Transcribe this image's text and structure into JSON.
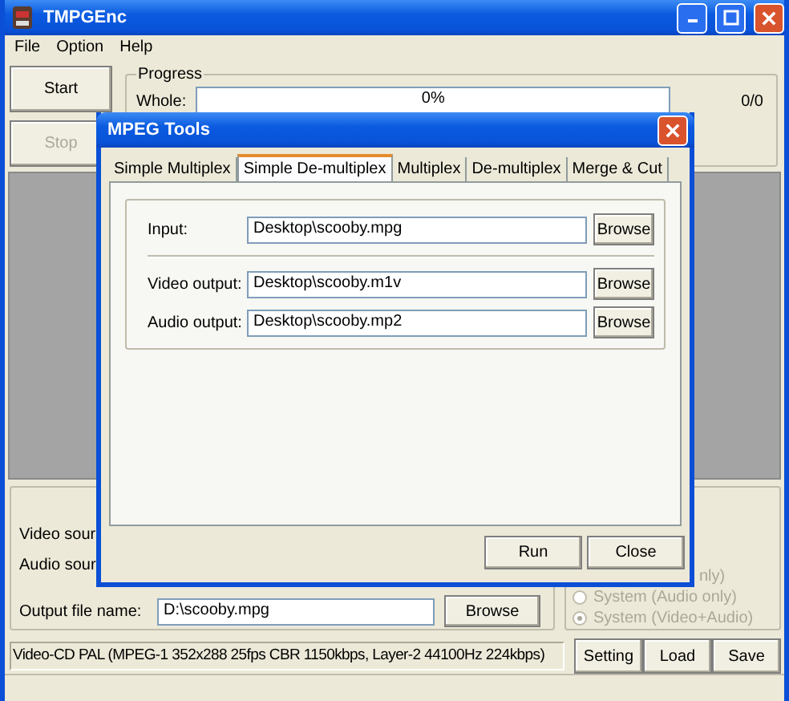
{
  "window": {
    "title": "TMPGEnc",
    "menu": [
      "File",
      "Option",
      "Help"
    ]
  },
  "actions": [
    {
      "label": "Start",
      "disabled": false
    },
    {
      "label": "Stop",
      "disabled": true
    }
  ],
  "progress": {
    "title": "Progress",
    "label": "Whole:",
    "level": 0,
    "reading": "0%",
    "count": "0/0"
  },
  "sources": [
    {
      "label": "Video sour"
    },
    {
      "label": "Audio sour"
    }
  ],
  "output": {
    "label": "Output file name:",
    "value": "D:\\scooby.mpg",
    "button": "Browse"
  },
  "stream_types": [
    {
      "kind": "cut",
      "label": "nly)",
      "disabled": true
    },
    {
      "kind": "radio",
      "label": "System (Audio only)",
      "selected": false,
      "disabled": true
    },
    {
      "kind": "radio",
      "label": "System (Video+Audio)",
      "selected": true,
      "disabled": true
    }
  ],
  "status": "Video-CD PAL (MPEG-1 352x288 25fps CBR 1150kbps,  Layer-2 44100Hz 224kbps)",
  "buttons": [
    "Setting",
    "Load",
    "Save"
  ],
  "dialog": {
    "title": "MPEG Tools",
    "tabs": [
      {
        "label": "Simple Multiplex",
        "selected": false
      },
      {
        "label": "Simple De-multiplex",
        "selected": true
      },
      {
        "label": "Multiplex",
        "selected": false
      },
      {
        "label": "De-multiplex",
        "selected": false
      },
      {
        "label": "Merge & Cut",
        "selected": false
      }
    ],
    "fields": [
      {
        "label": "Input:",
        "value": "Desktop\\scooby.mpg",
        "button": "Browse"
      },
      {
        "label": "Video output:",
        "value": "Desktop\\scooby.m1v",
        "button": "Browse"
      },
      {
        "label": "Audio output:",
        "value": "Desktop\\scooby.mp2",
        "button": "Browse"
      }
    ],
    "buttons": [
      "Run",
      "Close"
    ]
  }
}
